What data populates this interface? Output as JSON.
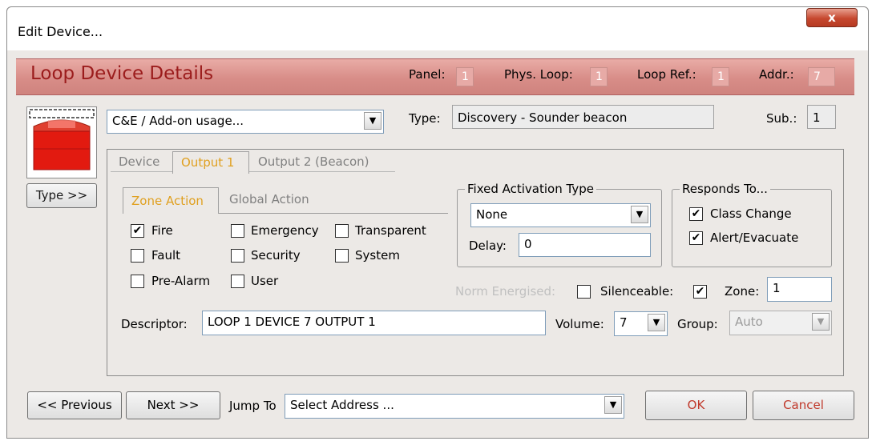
{
  "window": {
    "title": "Edit Device...",
    "close_glyph": "x"
  },
  "header": {
    "title": "Loop Device Details",
    "panel_label": "Panel:",
    "panel_value": "1",
    "phys_loop_label": "Phys. Loop:",
    "phys_loop_value": "1",
    "loop_ref_label": "Loop Ref.:",
    "loop_ref_value": "1",
    "addr_label": "Addr.:",
    "addr_value": "7"
  },
  "device": {
    "usage_select": "C&E / Add-on usage...",
    "type_label": "Type:",
    "type_value": "Discovery - Sounder beacon",
    "sub_label": "Sub.:",
    "sub_value": "1",
    "type_button": "Type >>"
  },
  "tabs": {
    "device": "Device",
    "output1": "Output 1",
    "output2": "Output 2 (Beacon)"
  },
  "subtabs": {
    "zone_action": "Zone Action",
    "global_action": "Global Action"
  },
  "actions": {
    "fire": {
      "label": "Fire",
      "checked": true
    },
    "emergency": {
      "label": "Emergency",
      "checked": false
    },
    "transparent": {
      "label": "Transparent",
      "checked": false
    },
    "fault": {
      "label": "Fault",
      "checked": false
    },
    "security": {
      "label": "Security",
      "checked": false
    },
    "system": {
      "label": "System",
      "checked": false
    },
    "pre_alarm": {
      "label": "Pre-Alarm",
      "checked": false
    },
    "user": {
      "label": "User",
      "checked": false
    }
  },
  "fixed_activation": {
    "legend": "Fixed Activation Type",
    "selected": "None",
    "delay_label": "Delay:",
    "delay_value": "0"
  },
  "responds_to": {
    "legend": "Responds To...",
    "class_change": {
      "label": "Class Change",
      "checked": true
    },
    "alert_evacuate": {
      "label": "Alert/Evacuate",
      "checked": true
    }
  },
  "norm_energised": {
    "label": "Norm Energised:",
    "checked": false
  },
  "silenceable": {
    "label": "Silenceable:",
    "checked": true
  },
  "zone": {
    "label": "Zone:",
    "value": "1"
  },
  "descriptor": {
    "label": "Descriptor:",
    "value": "LOOP 1 DEVICE 7 OUTPUT 1"
  },
  "volume": {
    "label": "Volume:",
    "value": "7"
  },
  "group": {
    "label": "Group:",
    "value": "Auto"
  },
  "footer": {
    "previous": "<< Previous",
    "next": "Next >>",
    "jump_label": "Jump To",
    "jump_value": "Select Address ...",
    "ok": "OK",
    "cancel": "Cancel"
  },
  "colors": {
    "banner": "#d88d88",
    "banner_title": "#9b1c1c",
    "active_tab": "#e0a020",
    "ok_text": "#c0392b",
    "cancel_text": "#c0392b"
  }
}
